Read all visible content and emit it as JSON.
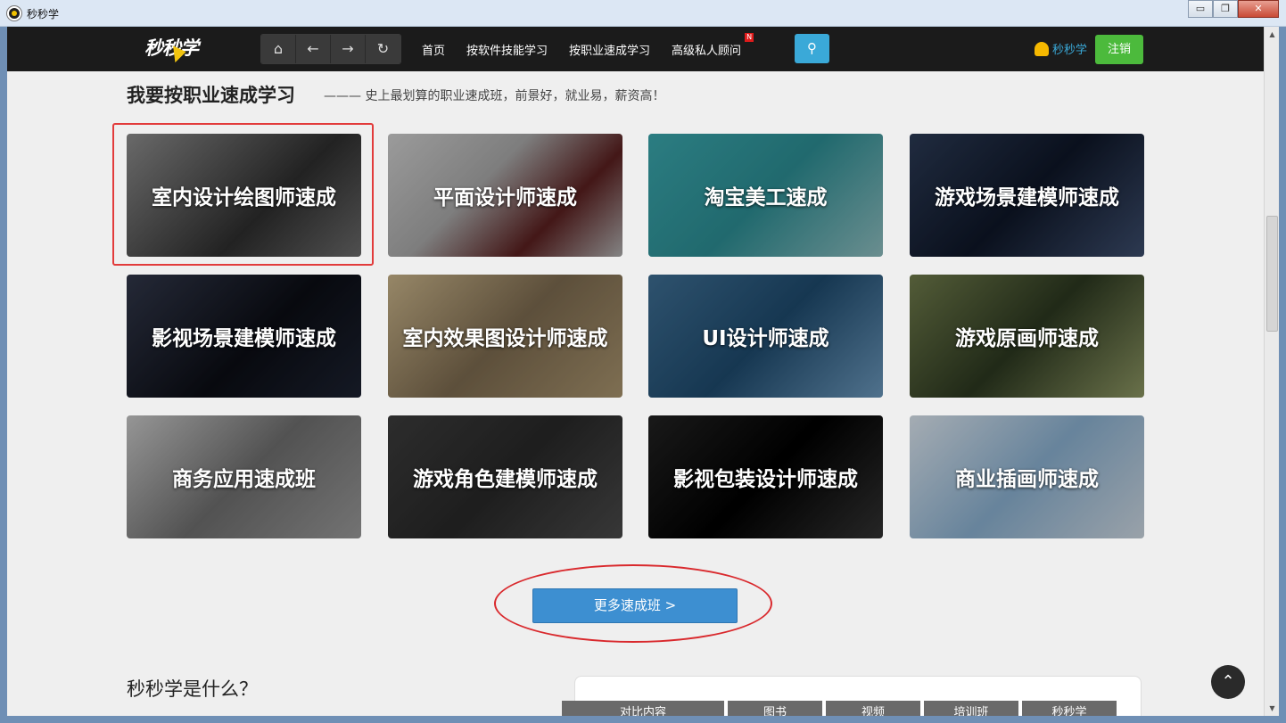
{
  "window": {
    "title": "秒秒学",
    "minimize": "▭",
    "maximize": "❐",
    "close": "✕"
  },
  "nav": {
    "logo": "秒秒学",
    "buttons": {
      "home": "⌂",
      "back": "←",
      "forward": "→",
      "refresh": "↻"
    },
    "links": [
      "首页",
      "按软件技能学习",
      "按职业速成学习",
      "高级私人顾问"
    ],
    "badge": "N",
    "search_icon": "⚲",
    "user": "秒秒学",
    "logout": "注销"
  },
  "section": {
    "title": "我要按职业速成学习",
    "subtitle": "——— 史上最划算的职业速成班，前景好，就业易，薪资高！"
  },
  "courses": [
    "室内设计绘图师速成",
    "平面设计师速成",
    "淘宝美工速成",
    "游戏场景建模师速成",
    "影视场景建模师速成",
    "室内效果图设计师速成",
    "UI设计师速成",
    "游戏原画师速成",
    "商务应用速成班",
    "游戏角色建模师速成",
    "影视包装设计师速成",
    "商业插画师速成"
  ],
  "more_button": "更多速成班 >",
  "what_title": "秒秒学是什么？",
  "compare_tabs": [
    "对比内容",
    "图书",
    "视频",
    "培训班",
    "秒秒学"
  ],
  "back_top": "⌃",
  "colors": {
    "nav_bg": "#1b1b1b",
    "accent_blue": "#3d8fd1",
    "logout_green": "#4cba3c",
    "highlight_red": "#e23b3b"
  }
}
